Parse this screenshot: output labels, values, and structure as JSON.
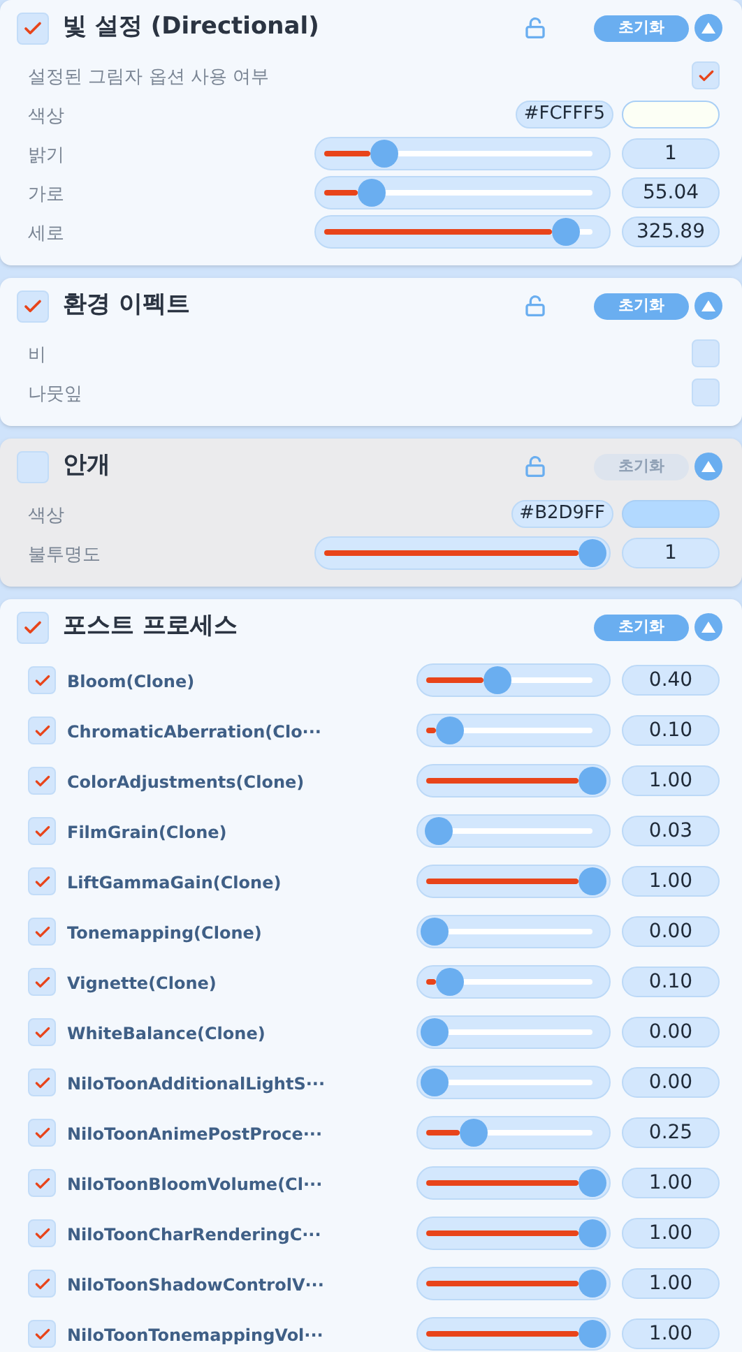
{
  "sections": [
    {
      "title": "빛 설정 (Directional)",
      "checked": true,
      "disabled": false,
      "lock": true,
      "reset": "초기화",
      "rows": [
        {
          "kind": "checkbox",
          "label": "설정된 그림자 옵션 사용 여부",
          "checked": true
        },
        {
          "kind": "color",
          "label": "색상",
          "hex": "#FCFFF5",
          "color": "#fcfff5"
        },
        {
          "kind": "slider",
          "label": "밝기",
          "level": 0.2,
          "value": "1"
        },
        {
          "kind": "slider",
          "label": "가로",
          "level": 0.15,
          "value": "55.04"
        },
        {
          "kind": "slider",
          "label": "세로",
          "level": 0.9,
          "value": "325.89"
        }
      ]
    },
    {
      "title": "환경 이펙트",
      "checked": true,
      "disabled": false,
      "lock": true,
      "reset": "초기화",
      "rows": [
        {
          "kind": "checkbox",
          "label": "비",
          "checked": false
        },
        {
          "kind": "checkbox",
          "label": "나뭇잎",
          "checked": false
        }
      ]
    },
    {
      "title": "안개",
      "checked": false,
      "disabled": true,
      "lock": true,
      "reset": "초기화",
      "rows": [
        {
          "kind": "color",
          "label": "색상",
          "hex": "#B2D9FF",
          "color": "#b2d9ff"
        },
        {
          "kind": "slider",
          "label": "불투명도",
          "level": 1,
          "value": "1"
        }
      ]
    },
    {
      "title": "포스트 프로세스",
      "checked": true,
      "disabled": false,
      "lock": false,
      "reset": "초기화",
      "rows": [
        {
          "kind": "effect",
          "label": "Bloom(Clone)",
          "checked": true,
          "level": 0.4,
          "value": "0.40"
        },
        {
          "kind": "effect",
          "label": "ChromaticAberration(Clo···",
          "checked": true,
          "level": 0.1,
          "value": "0.10"
        },
        {
          "kind": "effect",
          "label": "ColorAdjustments(Clone)",
          "checked": true,
          "level": 1,
          "value": "1.00"
        },
        {
          "kind": "effect",
          "label": "FilmGrain(Clone)",
          "checked": true,
          "level": 0.03,
          "value": "0.03"
        },
        {
          "kind": "effect",
          "label": "LiftGammaGain(Clone)",
          "checked": true,
          "level": 1,
          "value": "1.00"
        },
        {
          "kind": "effect",
          "label": "Tonemapping(Clone)",
          "checked": true,
          "level": 0,
          "value": "0.00"
        },
        {
          "kind": "effect",
          "label": "Vignette(Clone)",
          "checked": true,
          "level": 0.1,
          "value": "0.10"
        },
        {
          "kind": "effect",
          "label": "WhiteBalance(Clone)",
          "checked": true,
          "level": 0,
          "value": "0.00"
        },
        {
          "kind": "effect",
          "label": "NiloToonAdditionalLightS···",
          "checked": true,
          "level": 0,
          "value": "0.00"
        },
        {
          "kind": "effect",
          "label": "NiloToonAnimePostProce···",
          "checked": true,
          "level": 0.25,
          "value": "0.25"
        },
        {
          "kind": "effect",
          "label": "NiloToonBloomVolume(Cl···",
          "checked": true,
          "level": 1,
          "value": "1.00"
        },
        {
          "kind": "effect",
          "label": "NiloToonCharRenderingC···",
          "checked": true,
          "level": 1,
          "value": "1.00"
        },
        {
          "kind": "effect",
          "label": "NiloToonShadowControlV···",
          "checked": true,
          "level": 1,
          "value": "1.00"
        },
        {
          "kind": "effect",
          "label": "NiloToonTonemappingVol···",
          "checked": true,
          "level": 1,
          "value": "1.00"
        }
      ]
    }
  ]
}
